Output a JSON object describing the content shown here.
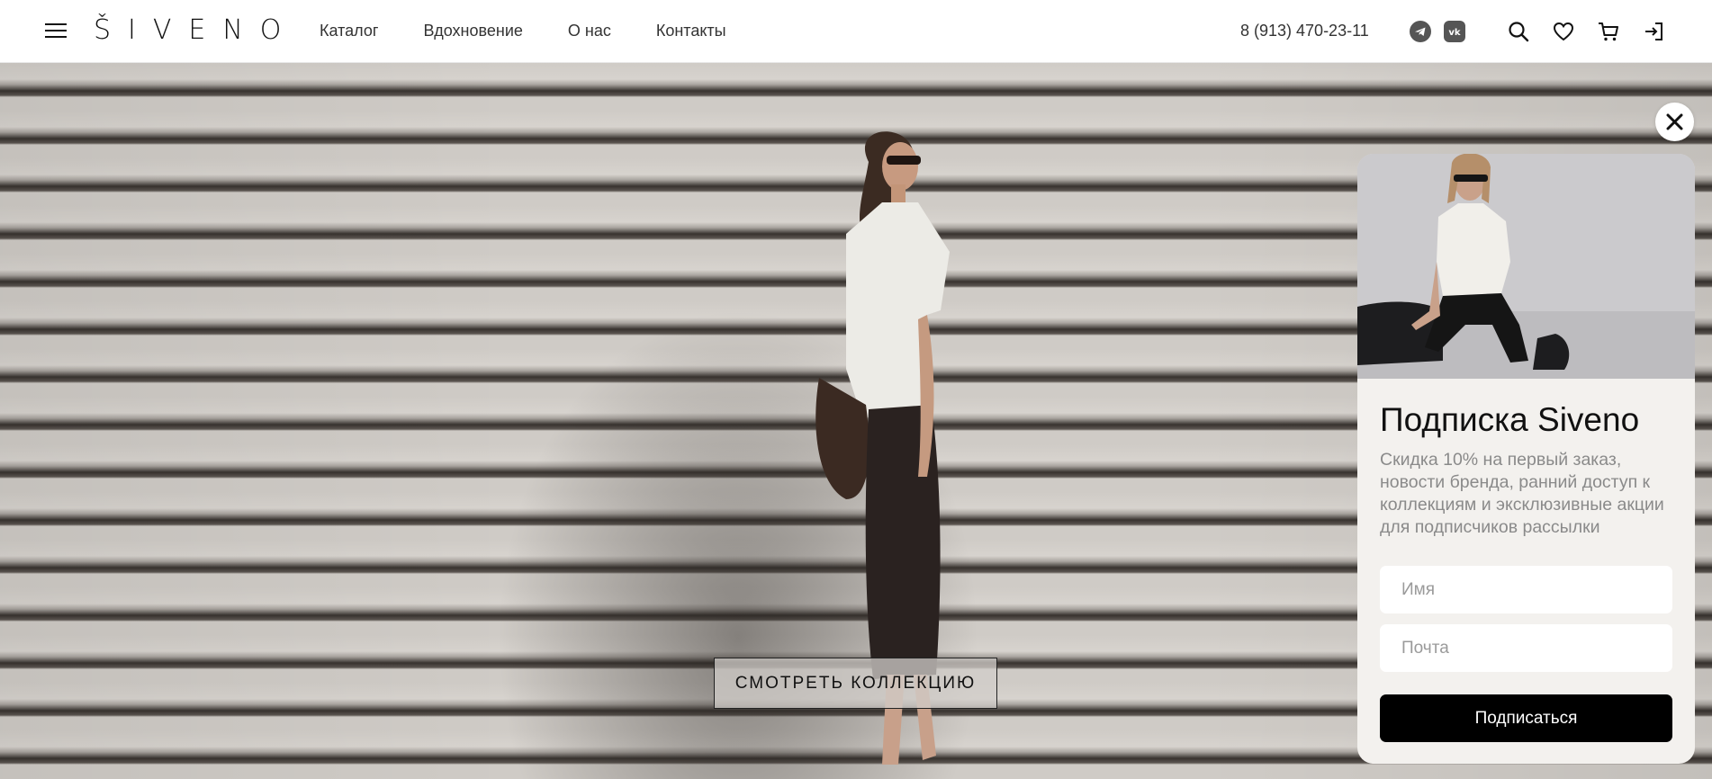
{
  "brand": {
    "logo": "ŠIVENO"
  },
  "header": {
    "nav": [
      {
        "label": "Каталог"
      },
      {
        "label": "Вдохновение"
      },
      {
        "label": "О нас"
      },
      {
        "label": "Контакты"
      }
    ],
    "phone": "8 (913) 470-23-11",
    "social_icons": [
      "telegram-icon",
      "vk-icon"
    ],
    "action_icons": [
      "search-icon",
      "heart-icon",
      "cart-icon",
      "login-icon"
    ]
  },
  "hero": {
    "cta_label": "СМОТРЕТЬ КОЛЛЕКЦИЮ"
  },
  "popup": {
    "title": "Подписка Siveno",
    "text": "Скидка 10% на первый заказ, новости бренда, ранний доступ к коллекциям и эксклюзивные акции для подписчиков рассылки",
    "name_placeholder": "Имя",
    "email_placeholder": "Почта",
    "submit_label": "Подписаться",
    "close_icon": "close-icon"
  },
  "colors": {
    "accent": "#000000",
    "popup_bg": "#f3f1ee",
    "text_muted": "#8a8a8a"
  }
}
